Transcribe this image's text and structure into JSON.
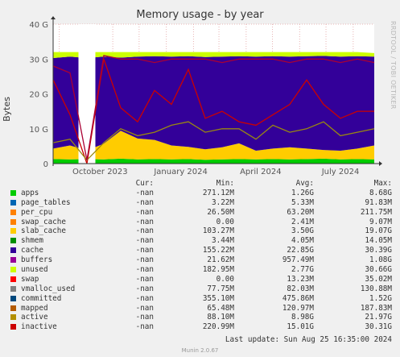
{
  "title": "Memory usage - by year",
  "side_label": "RRDTOOL / TOBI OETIKER",
  "chart_data": {
    "type": "area",
    "title": "Memory usage - by year",
    "ylabel": "Bytes",
    "y_ticks": [
      "0",
      "10 G",
      "20 G",
      "30 G",
      "40 G"
    ],
    "ylim": [
      0,
      40
    ],
    "y_unit": "G",
    "x_ticks": [
      "October 2023",
      "January 2024",
      "April 2024",
      "July 2024"
    ],
    "xlim": [
      "2023-08-25",
      "2024-08-25"
    ],
    "grid": true,
    "stacked_series": [
      "apps",
      "slab_cache",
      "cache",
      "unused"
    ],
    "line_series": [
      "swap",
      "active",
      "inactive"
    ],
    "series": [
      {
        "name": "apps",
        "values": [
          1.3,
          1.2,
          1.3,
          1.2,
          1.4,
          1.2,
          1.3,
          1.2,
          1.3,
          1.1,
          1.2,
          1.3,
          1.2,
          1.3,
          1.2,
          1.3,
          1.4,
          1.2,
          1.3,
          1.2
        ]
      },
      {
        "name": "slab_cache",
        "values": [
          3.0,
          4.0,
          2.5,
          4.5,
          8.0,
          6.0,
          5.5,
          4.0,
          3.5,
          3.0,
          3.5,
          4.5,
          2.5,
          3.0,
          3.5,
          3.0,
          2.5,
          2.5,
          3.0,
          4.0
        ]
      },
      {
        "name": "cache",
        "values": [
          26.0,
          25.5,
          26.5,
          25.0,
          21.0,
          23.5,
          24.0,
          25.5,
          26.0,
          26.5,
          26.0,
          25.0,
          27.0,
          26.5,
          26.0,
          26.5,
          27.0,
          27.0,
          26.5,
          25.5
        ]
      },
      {
        "name": "unused",
        "values": [
          1.7,
          1.3,
          1.7,
          1.3,
          1.6,
          1.3,
          1.2,
          1.3,
          1.2,
          1.4,
          1.3,
          1.2,
          1.3,
          1.2,
          1.3,
          1.2,
          1.1,
          1.3,
          1.2,
          1.0
        ]
      },
      {
        "name": "swap",
        "values": [
          24.0,
          14.0,
          0.0,
          30.0,
          16.0,
          12.0,
          21.0,
          17.0,
          27.0,
          13.0,
          15.0,
          12.0,
          11.0,
          14.0,
          17.0,
          24.0,
          17.0,
          13.0,
          15.0,
          15.0
        ]
      },
      {
        "name": "active",
        "values": [
          6.0,
          7.0,
          1.0,
          6.0,
          10.0,
          8.0,
          9.0,
          11.0,
          12.0,
          9.0,
          10.0,
          10.0,
          7.0,
          11.0,
          9.0,
          10.0,
          12.0,
          8.0,
          9.0,
          10.0
        ]
      },
      {
        "name": "inactive",
        "values": [
          28.0,
          26.0,
          1.0,
          31.0,
          30.0,
          30.0,
          29.0,
          30.0,
          30.0,
          30.0,
          29.0,
          30.0,
          30.0,
          30.0,
          29.0,
          30.0,
          30.0,
          29.0,
          30.0,
          29.0
        ]
      }
    ],
    "gaps": [
      [
        2,
        2
      ]
    ],
    "colors": {
      "apps": "#00cc00",
      "slab_cache": "#ffcc00",
      "cache": "#330099",
      "unused": "#ccff00",
      "swap": "#cc0000",
      "active": "#998811",
      "inactive": "#aa0033"
    }
  },
  "legend": {
    "headers": {
      "cur": "Cur:",
      "min": "Min:",
      "avg": "Avg:",
      "max": "Max:"
    },
    "rows": [
      {
        "name": "apps",
        "color": "#00cc00",
        "cur": "-nan",
        "min": "271.12M",
        "avg": "1.26G",
        "max": "8.68G"
      },
      {
        "name": "page_tables",
        "color": "#0066b3",
        "cur": "-nan",
        "min": "3.22M",
        "avg": "5.33M",
        "max": "91.83M"
      },
      {
        "name": "per_cpu",
        "color": "#ff8000",
        "cur": "-nan",
        "min": "26.50M",
        "avg": "63.20M",
        "max": "211.75M"
      },
      {
        "name": "swap_cache",
        "color": "#ff8000",
        "cur": "-nan",
        "min": "0.00",
        "avg": "2.41M",
        "max": "9.07M"
      },
      {
        "name": "slab_cache",
        "color": "#ffcc00",
        "cur": "-nan",
        "min": "103.27M",
        "avg": "3.50G",
        "max": "19.07G"
      },
      {
        "name": "shmem",
        "color": "#008f00",
        "cur": "-nan",
        "min": "3.44M",
        "avg": "4.05M",
        "max": "14.05M"
      },
      {
        "name": "cache",
        "color": "#330099",
        "cur": "-nan",
        "min": "155.22M",
        "avg": "22.85G",
        "max": "30.39G"
      },
      {
        "name": "buffers",
        "color": "#990099",
        "cur": "-nan",
        "min": "21.62M",
        "avg": "957.49M",
        "max": "1.08G"
      },
      {
        "name": "unused",
        "color": "#ccff00",
        "cur": "-nan",
        "min": "182.95M",
        "avg": "2.77G",
        "max": "30.66G"
      },
      {
        "name": "swap",
        "color": "#ff0000",
        "cur": "-nan",
        "min": "0.00",
        "avg": "13.23M",
        "max": "35.02M"
      },
      {
        "name": "vmalloc_used",
        "color": "#808080",
        "cur": "-nan",
        "min": "77.75M",
        "avg": "82.03M",
        "max": "130.88M"
      },
      {
        "name": "committed",
        "color": "#00487d",
        "cur": "-nan",
        "min": "355.10M",
        "avg": "475.86M",
        "max": "1.52G"
      },
      {
        "name": "mapped",
        "color": "#b35a00",
        "cur": "-nan",
        "min": "65.48M",
        "avg": "120.97M",
        "max": "187.83M"
      },
      {
        "name": "active",
        "color": "#b38f00",
        "cur": "-nan",
        "min": "88.10M",
        "avg": "8.98G",
        "max": "21.97G"
      },
      {
        "name": "inactive",
        "color": "#cc0000",
        "cur": "-nan",
        "min": "220.99M",
        "avg": "15.01G",
        "max": "30.31G"
      }
    ]
  },
  "last_update": "Last update: Sun Aug 25 16:35:00 2024",
  "version": "Munin 2.0.67"
}
